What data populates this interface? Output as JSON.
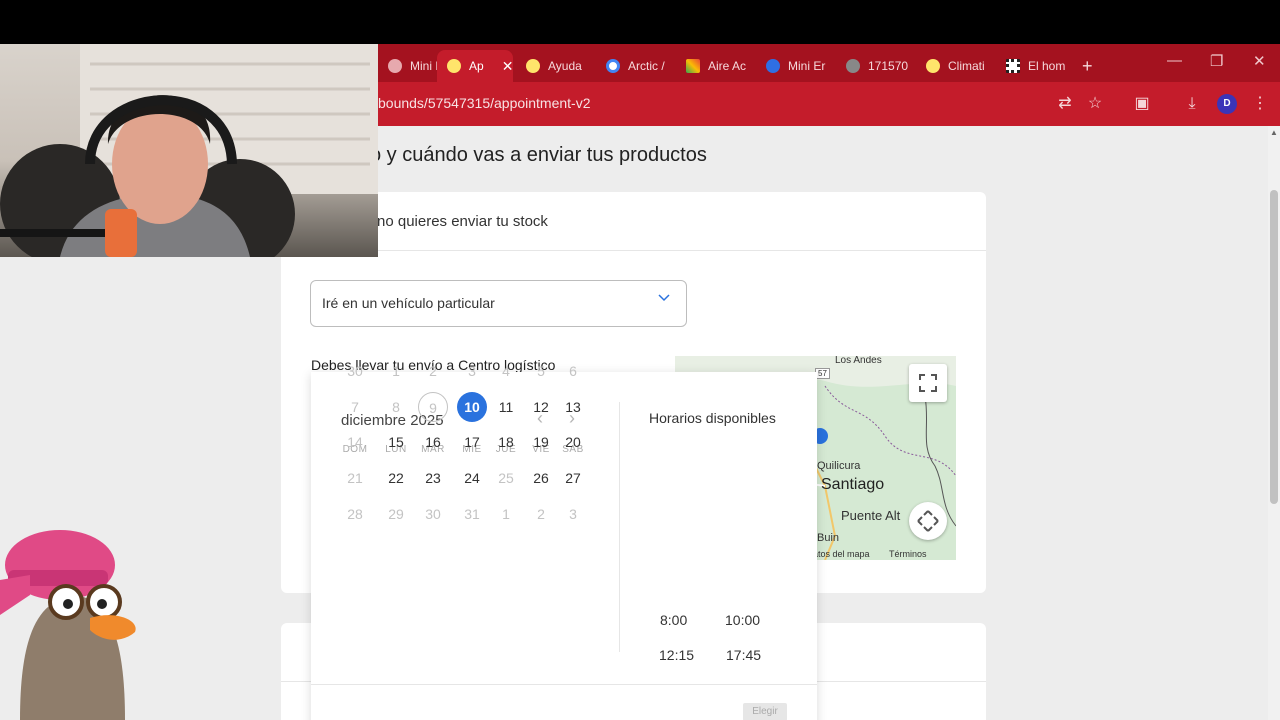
{
  "browser": {
    "tabs": [
      {
        "label": "Mini Er",
        "icon": "page-icon"
      },
      {
        "label": "Ap",
        "icon": "brand-icon",
        "active": true
      },
      {
        "label": "Ayuda",
        "icon": "brand-icon"
      },
      {
        "label": "Arctic /",
        "icon": "google-icon"
      },
      {
        "label": "Aire Ac",
        "icon": "colorful-icon"
      },
      {
        "label": "Mini Er",
        "icon": "blue-app-icon"
      },
      {
        "label": "171570",
        "icon": "globe-icon"
      },
      {
        "label": "Climati",
        "icon": "brand-icon"
      },
      {
        "label": "El hom",
        "icon": "grid-icon"
      }
    ],
    "new_tab": "+",
    "url": "bounds/57547315/appointment-v2",
    "avatar_letter": "D",
    "accent": "#c41c2b"
  },
  "page": {
    "heading": "o y cuándo vas a enviar tus productos",
    "card_title": "no quieres enviar tu stock",
    "select_value": "Iré en un vehículo particular",
    "destination_text": "Debes llevar tu envío a Centro logístico"
  },
  "map": {
    "labels": [
      "Los Andes",
      "Quilicura",
      "Santiago",
      "Puente Alt",
      "Buin",
      "atos del mapa",
      "Términos"
    ],
    "route_badge": "57"
  },
  "calendar": {
    "month": "diciembre 2025",
    "weekdays": [
      "DOM",
      "LUN",
      "MAR",
      "MIE",
      "JUE",
      "VIE",
      "SAB"
    ],
    "weeks": [
      [
        "30",
        "1",
        "2",
        "3",
        "4",
        "5",
        "6"
      ],
      [
        "7",
        "8",
        "9",
        "10",
        "11",
        "12",
        "13"
      ],
      [
        "14",
        "15",
        "16",
        "17",
        "18",
        "19",
        "20"
      ],
      [
        "21",
        "22",
        "23",
        "24",
        "25",
        "26",
        "27"
      ],
      [
        "28",
        "29",
        "30",
        "31",
        "1",
        "2",
        "3"
      ]
    ],
    "selected_day": "10",
    "today_day": "9",
    "slots_title": "Horarios disponibles",
    "slots": [
      "8:00",
      "10:00",
      "12:15",
      "17:45"
    ],
    "choose_label": "Elegir"
  }
}
